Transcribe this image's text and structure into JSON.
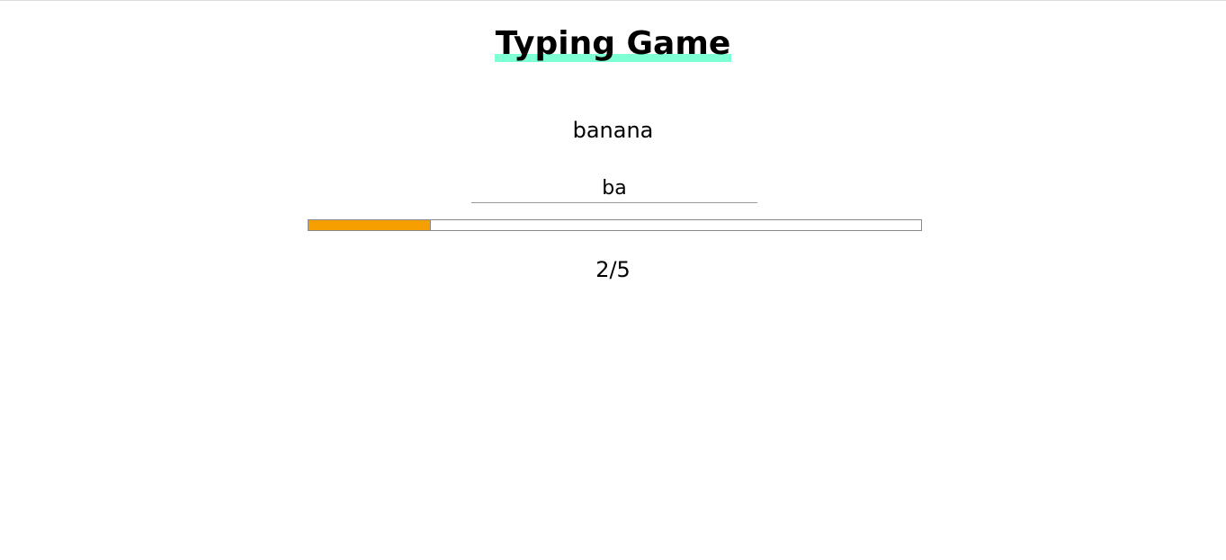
{
  "app": {
    "title": "Typing Game"
  },
  "game": {
    "target_word": "banana",
    "typed_value": "ba",
    "progress_fraction": 0.2,
    "counter_text": "2/5"
  },
  "colors": {
    "title_highlight": "#7fffd4",
    "progress_fill": "#f5a000",
    "progress_border": "#8a8a8a"
  }
}
